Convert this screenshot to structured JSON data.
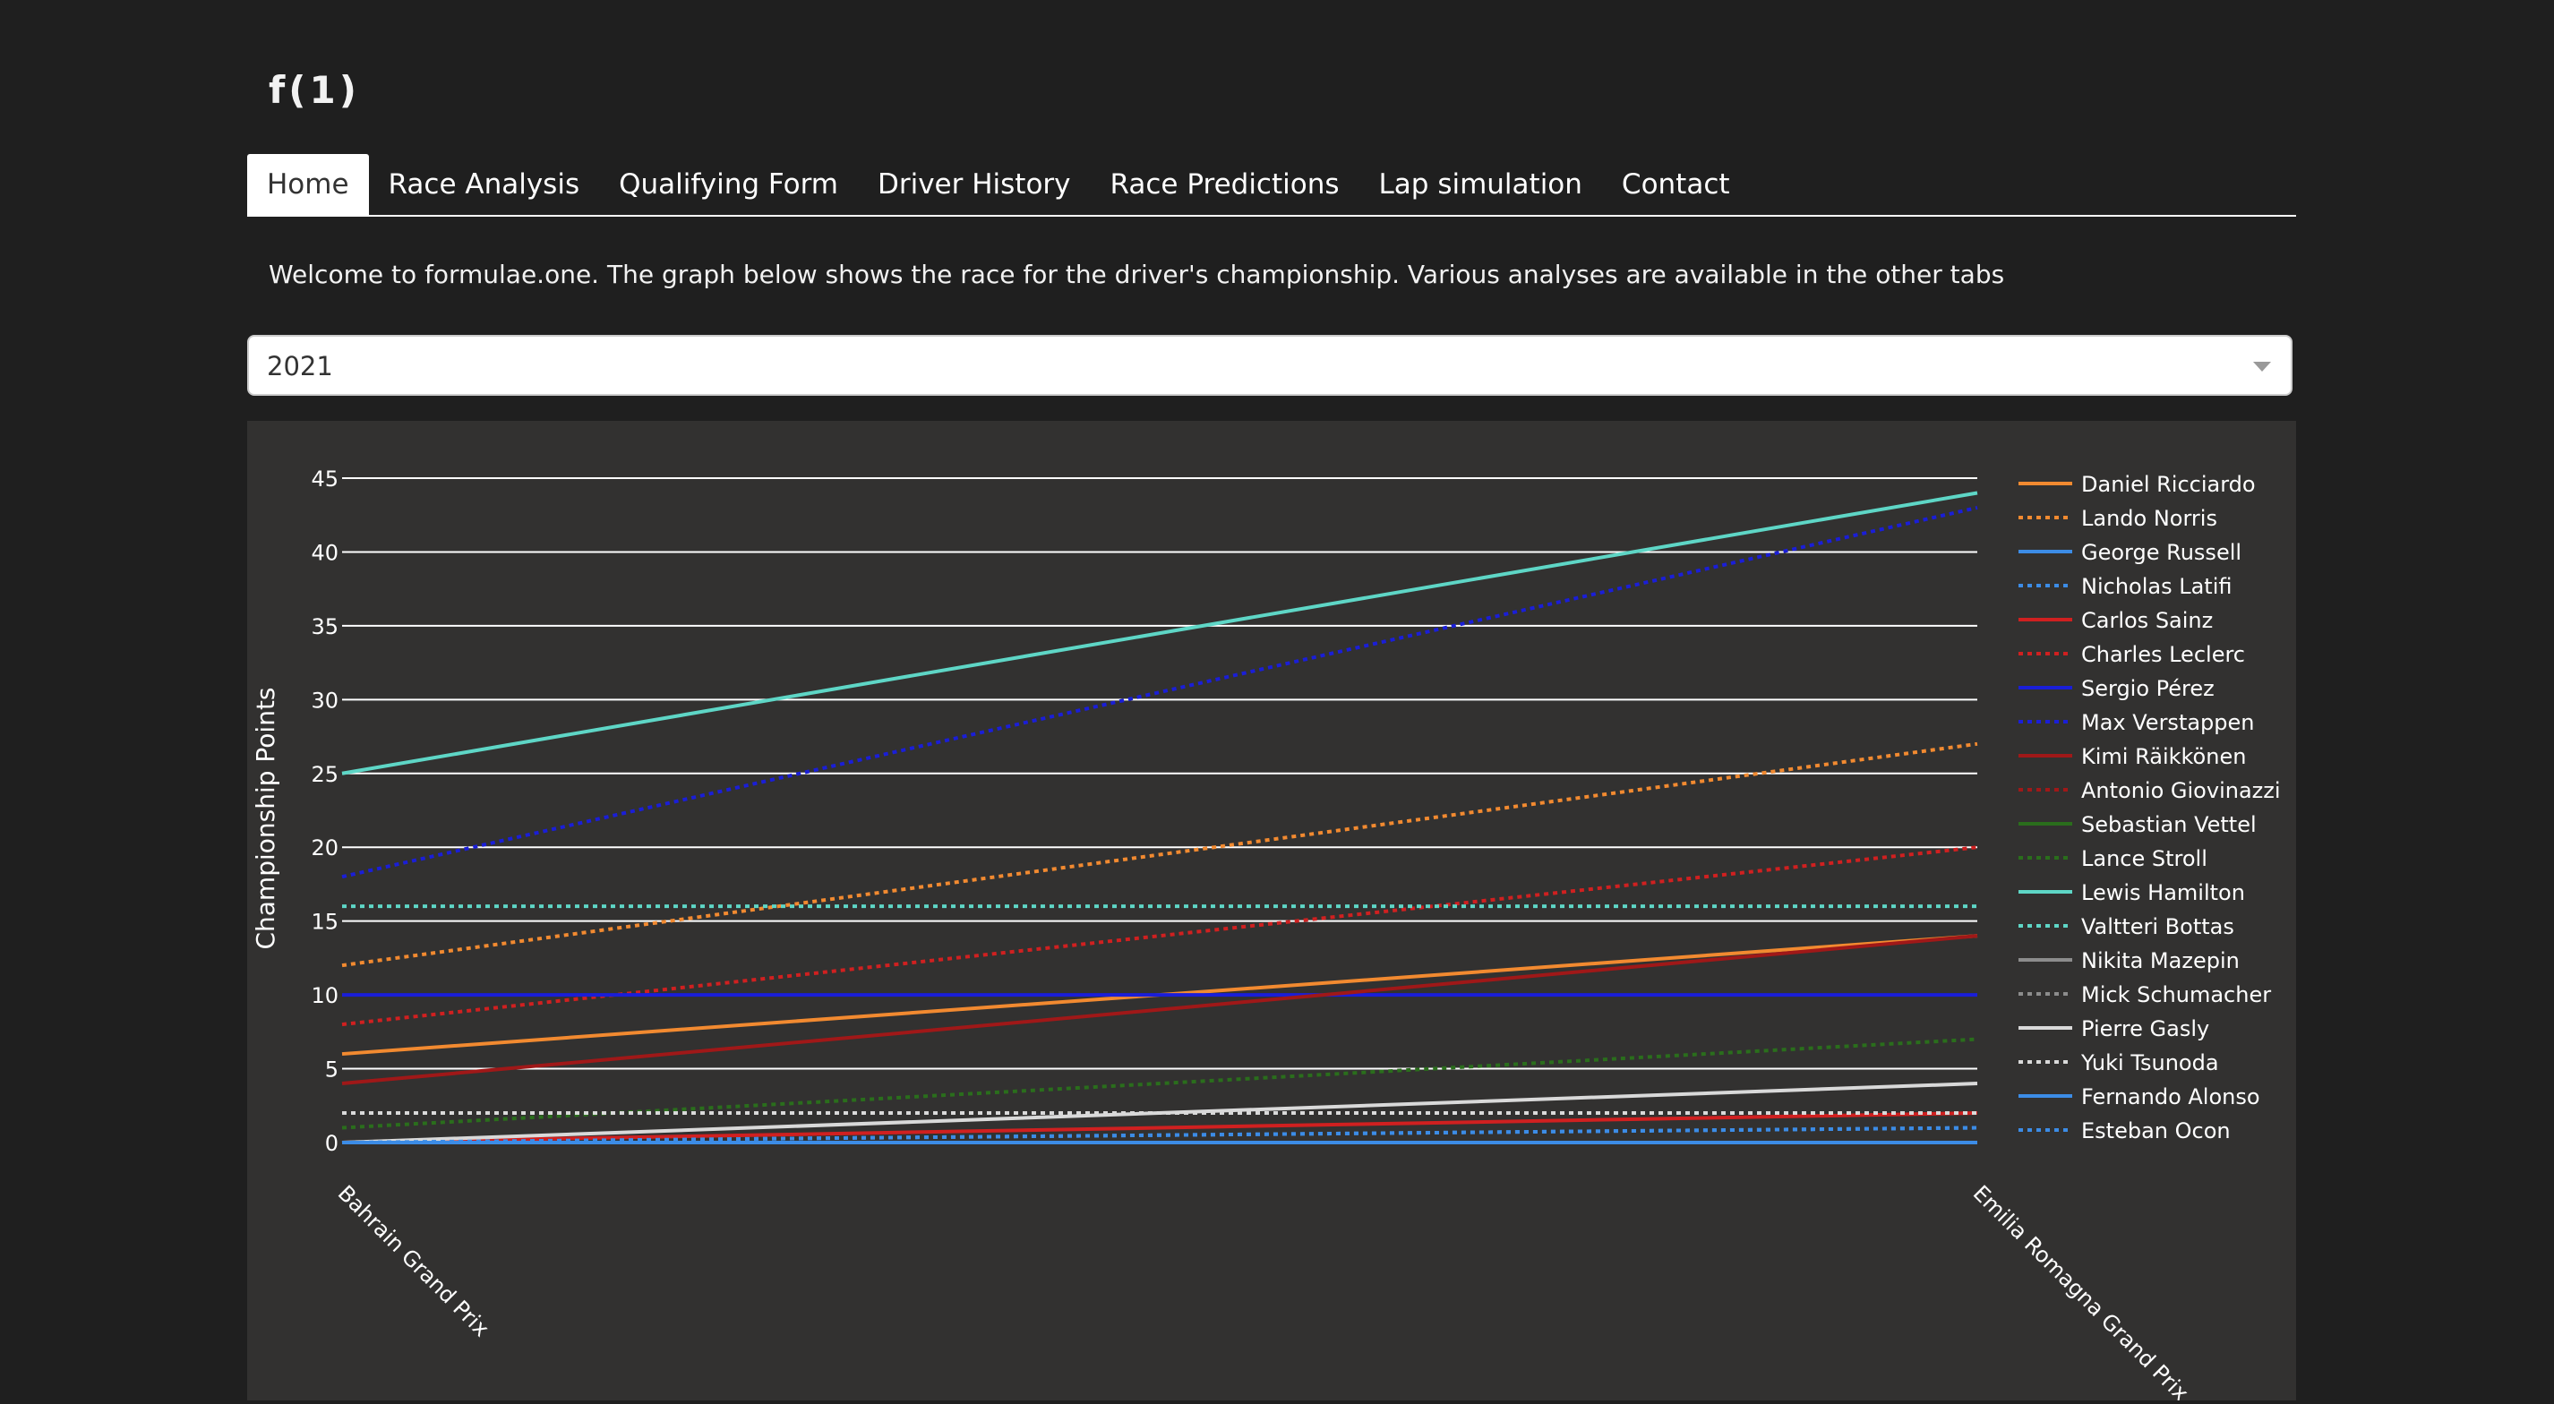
{
  "brand": "f(1)",
  "tabs": [
    {
      "label": "Home",
      "active": true
    },
    {
      "label": "Race Analysis",
      "active": false
    },
    {
      "label": "Qualifying Form",
      "active": false
    },
    {
      "label": "Driver History",
      "active": false
    },
    {
      "label": "Race Predictions",
      "active": false
    },
    {
      "label": "Lap simulation",
      "active": false
    },
    {
      "label": "Contact",
      "active": false
    }
  ],
  "welcome_text": "Welcome to formulae.one. The graph below shows the race for the driver's championship. Various analyses are available in the other tabs",
  "season_select": {
    "value": "2021"
  },
  "colors": {
    "page_bg": "#1f1f1f",
    "panel_bg": "#323130"
  },
  "chart_data": {
    "type": "line",
    "title": "",
    "xlabel": "",
    "ylabel": "Championship Points",
    "categories": [
      "Bahrain Grand Prix",
      "Emilia Romagna Grand Prix"
    ],
    "ylim": [
      0,
      45
    ],
    "yticks": [
      0,
      5,
      10,
      15,
      20,
      25,
      30,
      35,
      40,
      45
    ],
    "grid": true,
    "legend_position": "right",
    "series": [
      {
        "name": "Daniel Ricciardo",
        "values": [
          6,
          14
        ],
        "color": "#f28a30",
        "dash": "solid"
      },
      {
        "name": "Lando Norris",
        "values": [
          12,
          27
        ],
        "color": "#f28a30",
        "dash": "dot"
      },
      {
        "name": "George Russell",
        "values": [
          0,
          0
        ],
        "color": "#3c8ce6",
        "dash": "solid"
      },
      {
        "name": "Nicholas Latifi",
        "values": [
          0,
          1
        ],
        "color": "#3c8ce6",
        "dash": "dot"
      },
      {
        "name": "Carlos Sainz",
        "values": [
          0,
          2
        ],
        "color": "#d02020",
        "dash": "solid"
      },
      {
        "name": "Charles Leclerc",
        "values": [
          8,
          20
        ],
        "color": "#d02020",
        "dash": "dot"
      },
      {
        "name": "Sergio Pérez",
        "values": [
          10,
          10
        ],
        "color": "#1a1ed8",
        "dash": "solid"
      },
      {
        "name": "Max Verstappen",
        "values": [
          18,
          43
        ],
        "color": "#1a1ed8",
        "dash": "dot"
      },
      {
        "name": "Kimi Räikkönen",
        "values": [
          4,
          14
        ],
        "color": "#a01818",
        "dash": "solid"
      },
      {
        "name": "Antonio Giovinazzi",
        "values": [
          0,
          0
        ],
        "color": "#a01818",
        "dash": "dot"
      },
      {
        "name": "Sebastian Vettel",
        "values": [
          0,
          0
        ],
        "color": "#2a6e1c",
        "dash": "solid"
      },
      {
        "name": "Lance Stroll",
        "values": [
          1,
          7
        ],
        "color": "#2a6e1c",
        "dash": "dot"
      },
      {
        "name": "Lewis Hamilton",
        "values": [
          25,
          44
        ],
        "color": "#5ed6c6",
        "dash": "solid"
      },
      {
        "name": "Valtteri Bottas",
        "values": [
          16,
          16
        ],
        "color": "#5ed6c6",
        "dash": "dot"
      },
      {
        "name": "Nikita Mazepin",
        "values": [
          0,
          0
        ],
        "color": "#8c8c8c",
        "dash": "solid"
      },
      {
        "name": "Mick Schumacher",
        "values": [
          0,
          0
        ],
        "color": "#8c8c8c",
        "dash": "dot"
      },
      {
        "name": "Pierre Gasly",
        "values": [
          0,
          4
        ],
        "color": "#d9d9d9",
        "dash": "solid"
      },
      {
        "name": "Yuki Tsunoda",
        "values": [
          2,
          2
        ],
        "color": "#d9d9d9",
        "dash": "dot"
      },
      {
        "name": "Fernando Alonso",
        "values": [
          0,
          0
        ],
        "color": "#3c8ce6",
        "dash": "solid"
      },
      {
        "name": "Esteban Ocon",
        "values": [
          0,
          1
        ],
        "color": "#3c8ce6",
        "dash": "dot"
      }
    ]
  }
}
